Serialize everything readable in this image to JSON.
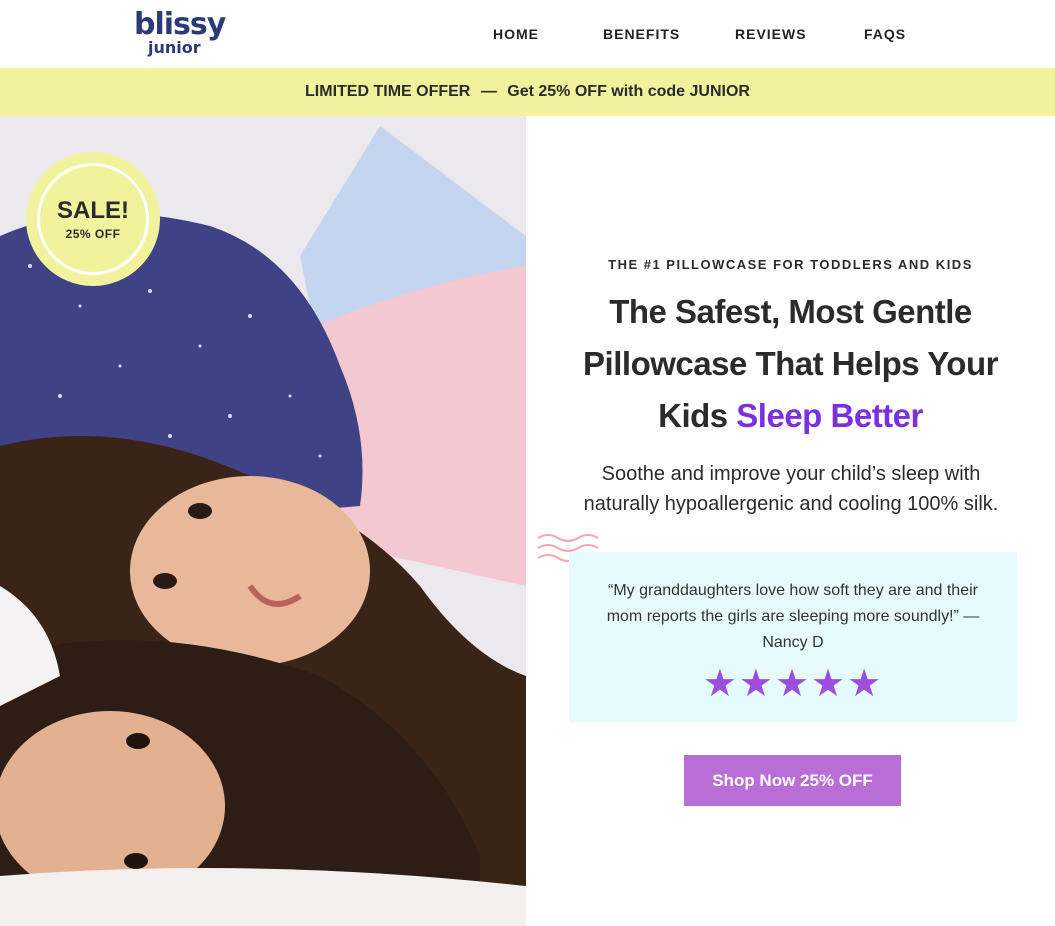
{
  "header": {
    "logo_main": "blissy",
    "logo_sub": "junior",
    "nav": [
      {
        "label": "HOME"
      },
      {
        "label": "BENEFITS"
      },
      {
        "label": "REVIEWS"
      },
      {
        "label": "FAQS"
      }
    ]
  },
  "promo": {
    "lead": "LIMITED TIME OFFER",
    "separator": "—",
    "offer": "Get 25% OFF with code JUNIOR"
  },
  "badge": {
    "title": "SALE!",
    "subtitle": "25% OFF"
  },
  "hero": {
    "eyebrow": "THE #1 PILLOWCASE FOR TODDLERS AND KIDS",
    "headline_line1": "The Safest, Most Gentle",
    "headline_line2": "Pillowcase That Helps Your",
    "headline_line3_start": "Kids",
    "headline_accent": "Sleep Better",
    "subcopy": "Soothe and improve your child’s sleep with naturally hypoallergenic and cooling 100% silk."
  },
  "review": {
    "quote": "“My granddaughters love how soft they are and their mom reports the girls are sleeping more soundly!” —",
    "author": "Nancy D",
    "rating": 5,
    "stars": "★★★★★"
  },
  "cta": {
    "label": "Shop Now 25% OFF"
  },
  "colors": {
    "brand_navy": "#2d3a78",
    "promo_yellow": "#f2f29d",
    "accent_purple": "#7b30e0",
    "star_purple": "#9b4ee0",
    "cta_purple": "#b86ed6",
    "review_bg": "#e6fbfd"
  }
}
